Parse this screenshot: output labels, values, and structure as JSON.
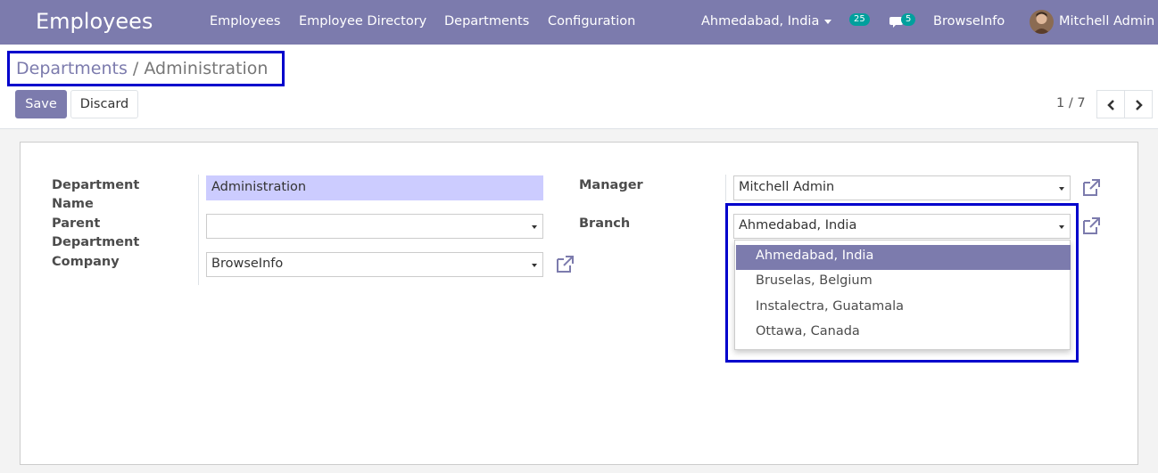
{
  "navbar": {
    "app_name": "Employees",
    "menu": [
      "Employees",
      "Employee Directory",
      "Departments",
      "Configuration"
    ],
    "branch_switcher": "Ahmedabad, India",
    "activity_count": "25",
    "messages_count": "5",
    "company": "BrowseInfo",
    "user": "Mitchell Admin"
  },
  "breadcrumb": {
    "parent": "Departments",
    "separator": "/",
    "current": "Administration"
  },
  "actions": {
    "save_label": "Save",
    "discard_label": "Discard"
  },
  "pager": {
    "value": "1 / 7"
  },
  "form": {
    "department_name_label_1": "Department",
    "department_name_label_2": "Name",
    "department_name_value": "Administration",
    "parent_label_1": "Parent",
    "parent_label_2": "Department",
    "parent_value": "",
    "company_label": "Company",
    "company_value": "BrowseInfo",
    "manager_label": "Manager",
    "manager_value": "Mitchell Admin",
    "branch_label": "Branch",
    "branch_value": "Ahmedabad, India"
  },
  "branch_dropdown": {
    "options": [
      "Ahmedabad, India",
      "Bruselas, Belgium",
      "Instalectra, Guatamala",
      "Ottawa, Canada"
    ],
    "highlighted": "Ahmedabad, India"
  },
  "colors": {
    "brand": "#7c7bad",
    "badge": "#00a09d",
    "highlight_border": "#0000cc",
    "focused_input": "#ccccff"
  },
  "icons": [
    "chevron-left-icon",
    "chevron-right-icon",
    "external-link-icon",
    "chat-icon",
    "caret-down-icon"
  ]
}
